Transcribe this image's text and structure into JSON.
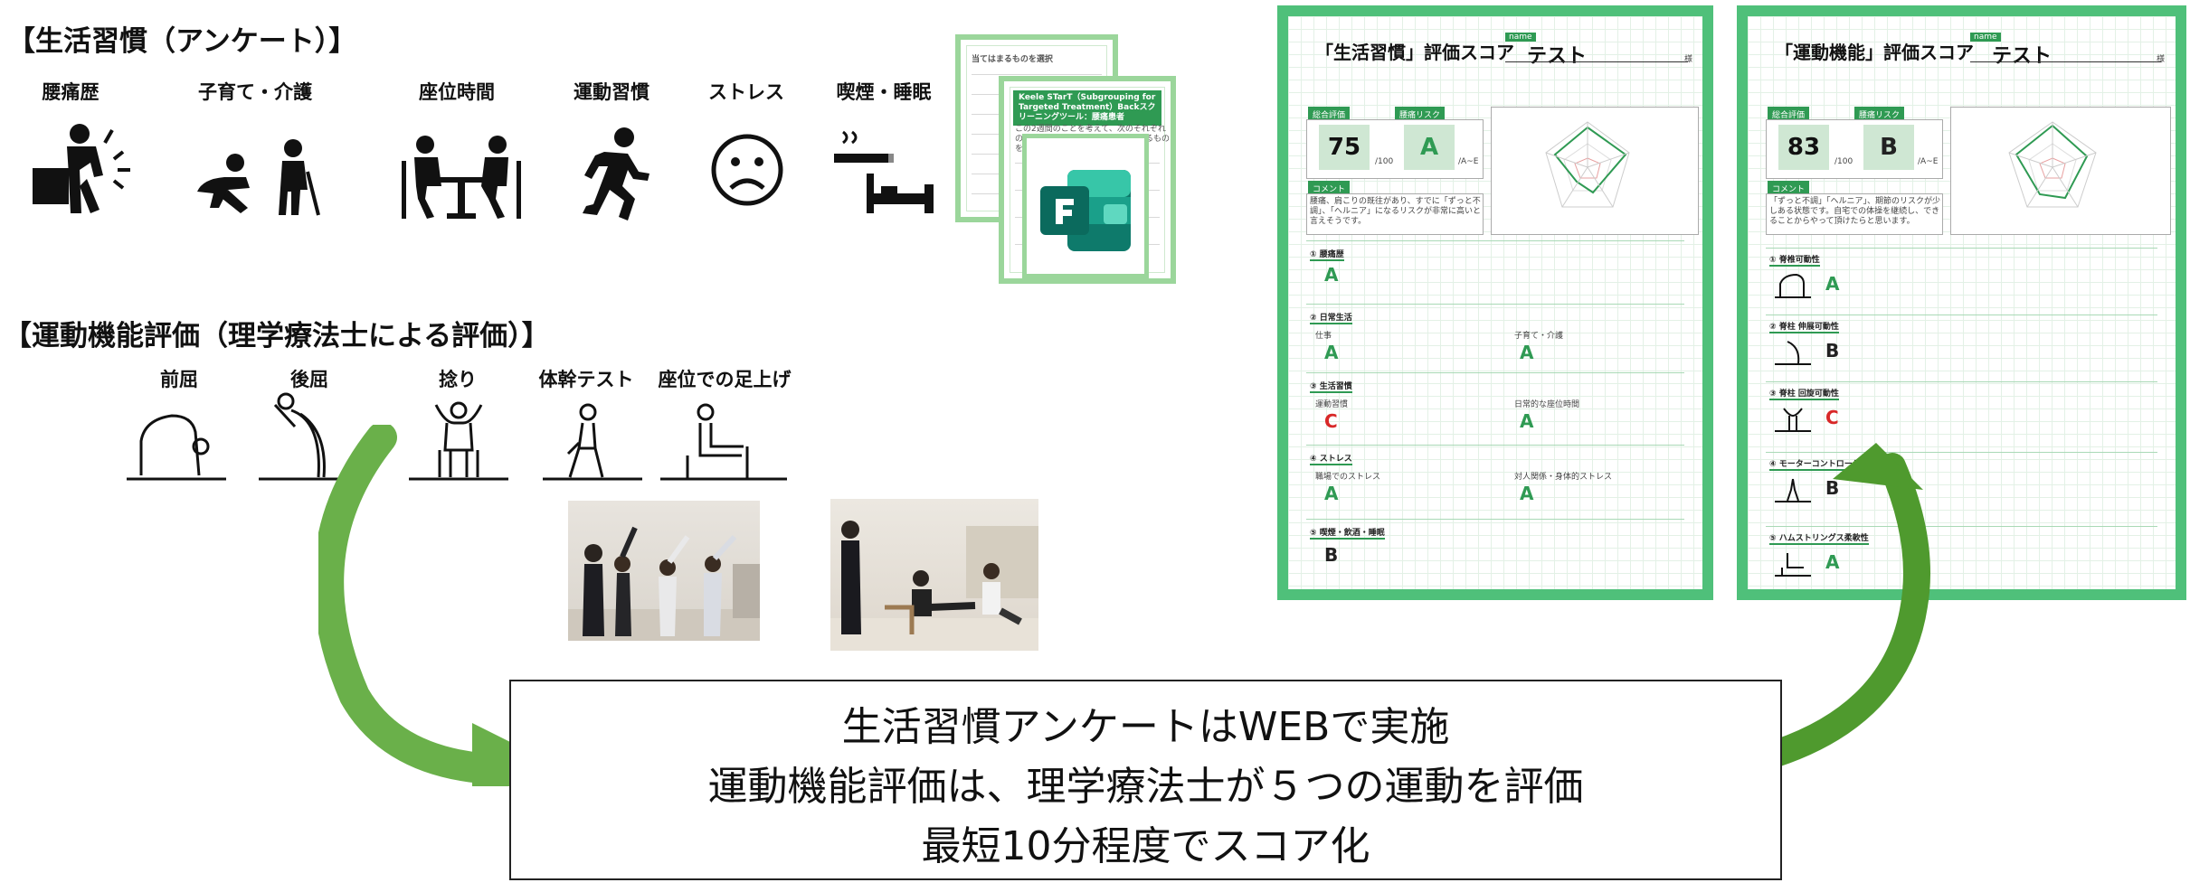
{
  "survey": {
    "heading": "【生活習慣（アンケート）】",
    "categories": [
      "腰痛歴",
      "子育て・介護",
      "座位時間",
      "運動習慣",
      "ストレス",
      "喫煙・睡眠"
    ]
  },
  "motor": {
    "heading": "【運動機能評価（理学療法士による評価）】",
    "tests": [
      "前屈",
      "後屈",
      "捻り",
      "体幹テスト",
      "座位での足上げ"
    ]
  },
  "questionnaire": {
    "back_title": "当てはまるものを選択",
    "front_title": "Keele STarT（Subgrouping for Targeted Treatment）Backスクリーニングツール：腰痛患者",
    "front_intro": "この2週間のことを考えて、次のそれぞれの質問に対するあなたの意見に関するものをチェックして下さい。"
  },
  "sheets": [
    {
      "title": "「生活習慣」評価スコア",
      "name_label": "name",
      "name": "テスト",
      "suffix": "様",
      "total_label": "総合評価",
      "risk_label": "腰痛リスク",
      "total_score": "75",
      "total_unit": "/100",
      "risk_grade": "A",
      "risk_unit": "/A~E",
      "comment_label": "コメント",
      "comment": "腰痛、肩こりの既往があり、すでに「ずっと不調」、「へルニア」になるリスクが非常に高いと言えそうです。",
      "sections": [
        {
          "title": "① 腰痛歴",
          "grade": "A"
        },
        {
          "title": "② 日常生活",
          "grade": "A"
        },
        {
          "title": "③ 生活習慣",
          "grade": "C"
        },
        {
          "title": "④ ストレス",
          "grade": "A"
        },
        {
          "title": "⑤ 喫煙・飲酒・睡眠",
          "grade": "B"
        }
      ],
      "sub_items": [
        "仕事",
        "子育て・介護",
        "運動習慣",
        "日常的な座位時間",
        "職場でのストレス",
        "対人関係・身体的ストレス"
      ],
      "sub_grades": [
        "A",
        "A",
        "C",
        "A",
        "A",
        "A"
      ]
    },
    {
      "title": "「運動機能」評価スコア",
      "name_label": "name",
      "name": "テスト",
      "suffix": "様",
      "total_label": "総合評価",
      "risk_label": "腰痛リスク",
      "total_score": "83",
      "total_unit": "/100",
      "risk_grade": "B",
      "risk_unit": "/A~E",
      "comment_label": "コメント",
      "comment": "「ずっと不調」「ヘルニア」、期節のリスクが少しある状態です。自宅での体操を継続し、できることからやって頂けたらと思います。",
      "sections": [
        {
          "title": "① 脊椎可動性",
          "grade": "A"
        },
        {
          "title": "② 脊柱 伸展可動性",
          "grade": "B"
        },
        {
          "title": "③ 脊柱 回旋可動性",
          "grade": "C"
        },
        {
          "title": "④ モーターコントロール",
          "grade": "B"
        },
        {
          "title": "⑤ ハムストリングス柔軟性",
          "grade": "A"
        }
      ]
    }
  ],
  "note": {
    "lines": [
      "生活習慣アンケートはWEBで実施",
      "運動機能評価は、理学療法士が５つの運動を評価",
      "最短10分程度でスコア化"
    ]
  },
  "colors": {
    "arrow_left": "#6ab04a",
    "arrow_right": "#4f9a2e",
    "sheet_border": "#4fc07a",
    "grade_a": "#2f9a53",
    "grade_c": "#d82828"
  }
}
